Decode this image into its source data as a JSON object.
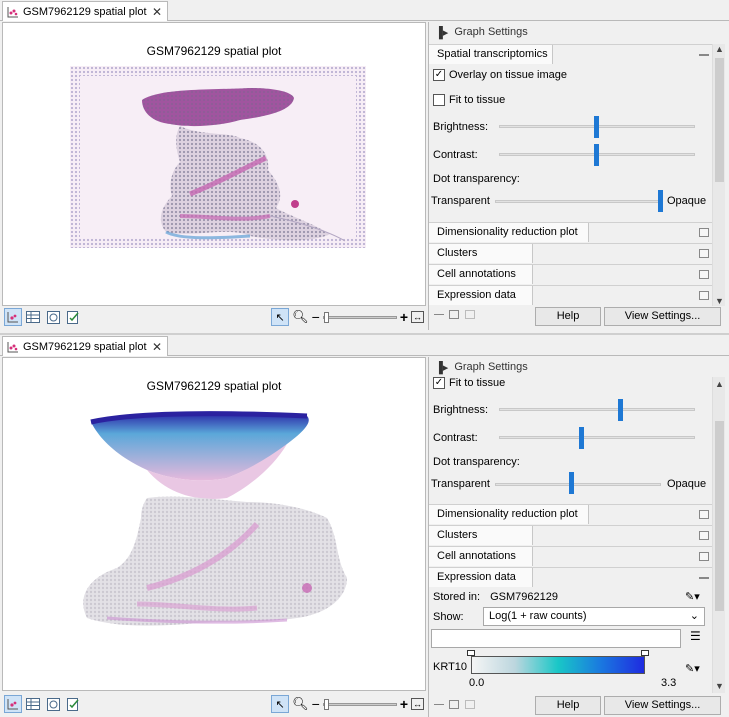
{
  "top": {
    "tab_title": "GSM7962129 spatial plot",
    "plot_title": "GSM7962129 spatial plot",
    "graph_settings": "Graph Settings",
    "section_spatial": "Spatial transcriptomics",
    "overlay_label": "Overlay on tissue image",
    "overlay_checked": true,
    "fit_label": "Fit to tissue",
    "fit_checked": false,
    "brightness_label": "Brightness:",
    "brightness_value": 0.5,
    "contrast_label": "Contrast:",
    "contrast_value": 0.5,
    "dot_label": "Dot transparency:",
    "transparent_label": "Transparent",
    "opaque_label": "Opaque",
    "dot_value": 1.0,
    "sections": [
      "Dimensionality reduction plot",
      "Clusters",
      "Cell annotations",
      "Expression data"
    ],
    "help": "Help",
    "view_settings": "View Settings..."
  },
  "bottom": {
    "tab_title": "GSM7962129 spatial plot",
    "plot_title": "GSM7962129 spatial plot",
    "graph_settings": "Graph Settings",
    "fit_label": "Fit to tissue",
    "fit_checked": true,
    "brightness_label": "Brightness:",
    "brightness_value": 0.62,
    "contrast_label": "Contrast:",
    "contrast_value": 0.42,
    "dot_label": "Dot transparency:",
    "transparent_label": "Transparent",
    "opaque_label": "Opaque",
    "dot_value": 0.46,
    "sections": [
      "Dimensionality reduction plot",
      "Clusters",
      "Cell annotations",
      "Expression data"
    ],
    "stored_in_label": "Stored in:",
    "stored_in_value": "GSM7962129",
    "show_label": "Show:",
    "show_value": "Log(1 + raw counts)",
    "gene": "KRT10",
    "scale_min": "0.0",
    "scale_max": "3.3",
    "help": "Help",
    "view_settings": "View Settings..."
  },
  "colors": {
    "accent": "#1e78d4",
    "tissue_pink": "#a0559f",
    "spot_blue": "#3f2fb0"
  }
}
